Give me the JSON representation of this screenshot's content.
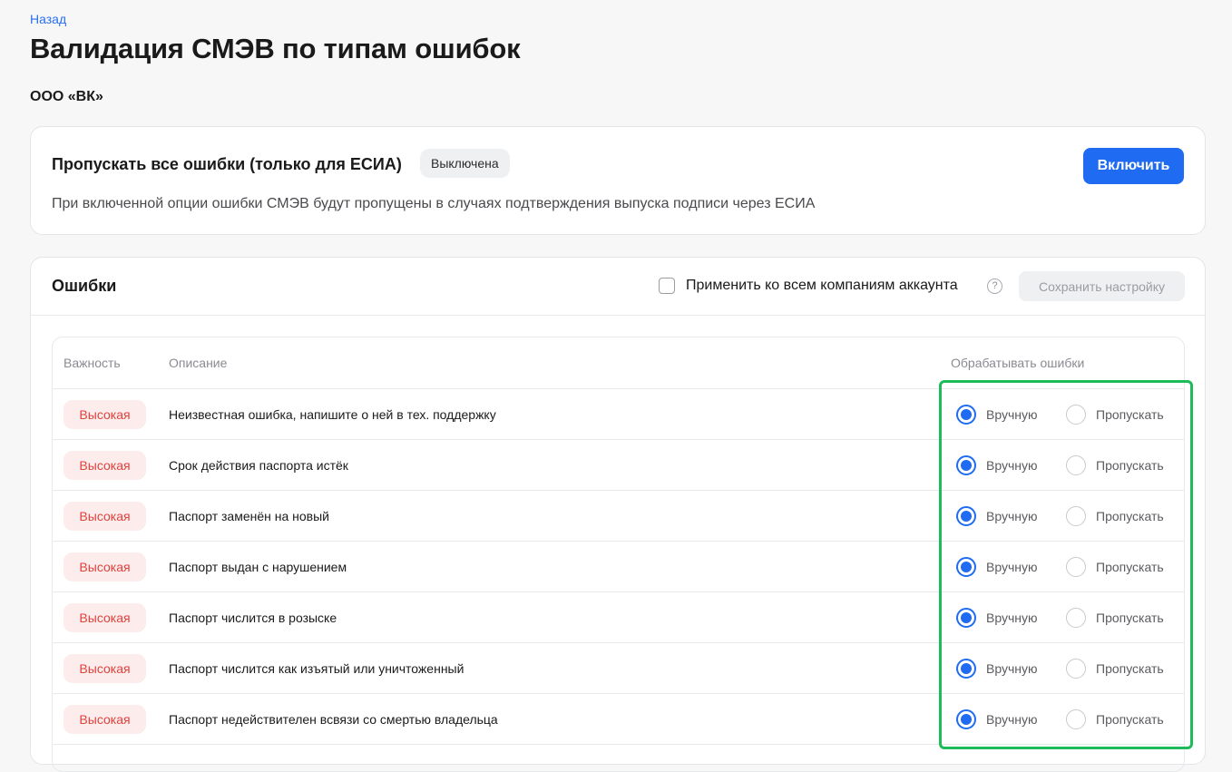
{
  "nav": {
    "back_label": "Назад"
  },
  "page": {
    "title": "Валидация СМЭВ по типам ошибок",
    "company": "ООО «ВК»"
  },
  "esia": {
    "title": "Пропускать все ошибки (только для ЕСИА)",
    "status": "Выключена",
    "description": "При включенной опции ошибки СМЭВ будут пропущены в случаях подтверждения выпуска подписи через ЕСИА",
    "enable_label": "Включить"
  },
  "errors": {
    "title": "Ошибки",
    "apply_all_label": "Применить ко всем компаниям аккаунта",
    "apply_all_checked": false,
    "save_label": "Сохранить настройку",
    "columns": {
      "severity": "Важность",
      "description": "Описание",
      "handling": "Обрабатывать ошибки"
    },
    "option_labels": {
      "manual": "Вручную",
      "skip": "Пропускать"
    },
    "rows": [
      {
        "severity": "Высокая",
        "description": "Неизвестная ошибка, напишите о ней в тех. поддержку",
        "selected": "manual"
      },
      {
        "severity": "Высокая",
        "description": "Срок действия паспорта истёк",
        "selected": "manual"
      },
      {
        "severity": "Высокая",
        "description": "Паспорт заменён на новый",
        "selected": "manual"
      },
      {
        "severity": "Высокая",
        "description": "Паспорт выдан с нарушением",
        "selected": "manual"
      },
      {
        "severity": "Высокая",
        "description": "Паспорт числится в розыске",
        "selected": "manual"
      },
      {
        "severity": "Высокая",
        "description": "Паспорт числится как изъятый или уничтоженный",
        "selected": "manual"
      },
      {
        "severity": "Высокая",
        "description": "Паспорт недействителен всвязи со смертью владельца",
        "selected": "manual"
      }
    ]
  },
  "colors": {
    "accent": "#1f6bf2",
    "severity_high_text": "#e0413c",
    "severity_high_bg": "#fdecec",
    "highlight": "#1dbb5a"
  },
  "icons": {
    "help": "question-circle-icon"
  }
}
